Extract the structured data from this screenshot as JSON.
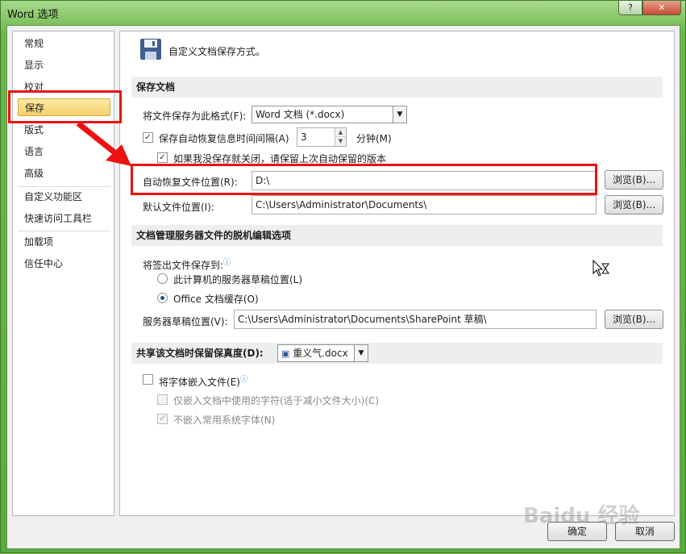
{
  "window": {
    "title": "Word 选项",
    "help": "?",
    "close": "✕"
  },
  "sidebar": {
    "items": [
      {
        "label": "常规"
      },
      {
        "label": "显示"
      },
      {
        "label": "校对"
      },
      {
        "label": "保存"
      },
      {
        "label": "版式"
      },
      {
        "label": "语言"
      },
      {
        "label": "高级"
      },
      {
        "label": "自定义功能区"
      },
      {
        "label": "快速访问工具栏"
      },
      {
        "label": "加载项"
      },
      {
        "label": "信任中心"
      }
    ]
  },
  "main": {
    "header_text": "自定义文档保存方式。",
    "save_section": {
      "title": "保存文档",
      "format_label": "将文件保存为此格式(F):",
      "format_value": "Word 文档 (*.docx)",
      "autorecover_label": "保存自动恢复信息时间间隔(A)",
      "autorecover_value": "3",
      "minutes_label": "分钟(M)",
      "keep_last_label": "如果我没保存就关闭，请保留上次自动保留的版本",
      "autorecover_location_label": "自动恢复文件位置(R):",
      "autorecover_location_value": "D:\\",
      "default_location_label": "默认文件位置(I):",
      "default_location_value": "C:\\Users\\Administrator\\Documents\\",
      "browse1": "浏览(B)...",
      "browse2": "浏览(B)..."
    },
    "offline_section": {
      "title": "文档管理服务器文件的脱机编辑选项",
      "checkout_label": "将签出文件保存到:",
      "radio1": "此计算机的服务器草稿位置(L)",
      "radio2": "Office 文档缓存(O)",
      "drafts_label": "服务器草稿位置(V):",
      "drafts_value": "C:\\Users\\Administrator\\Documents\\SharePoint 草稿\\",
      "browse3": "浏览(B)..."
    },
    "fidelity_section": {
      "title": "共享该文档时保留保真度(D):",
      "doc_value": "重义气.docx",
      "embed_fonts": "将字体嵌入文件(E)",
      "embed_used_only": "仅嵌入文档中使用的字符(适于减小文件大小)(C)",
      "no_common_fonts": "不嵌入常用系统字体(N)"
    }
  },
  "footer": {
    "ok": "确定",
    "cancel": "取消"
  },
  "watermark": "Baidu 经验",
  "colors": {
    "annotation": "#ee1111",
    "selected_nav": "#f7d06d",
    "frame": "#6cb84a"
  }
}
